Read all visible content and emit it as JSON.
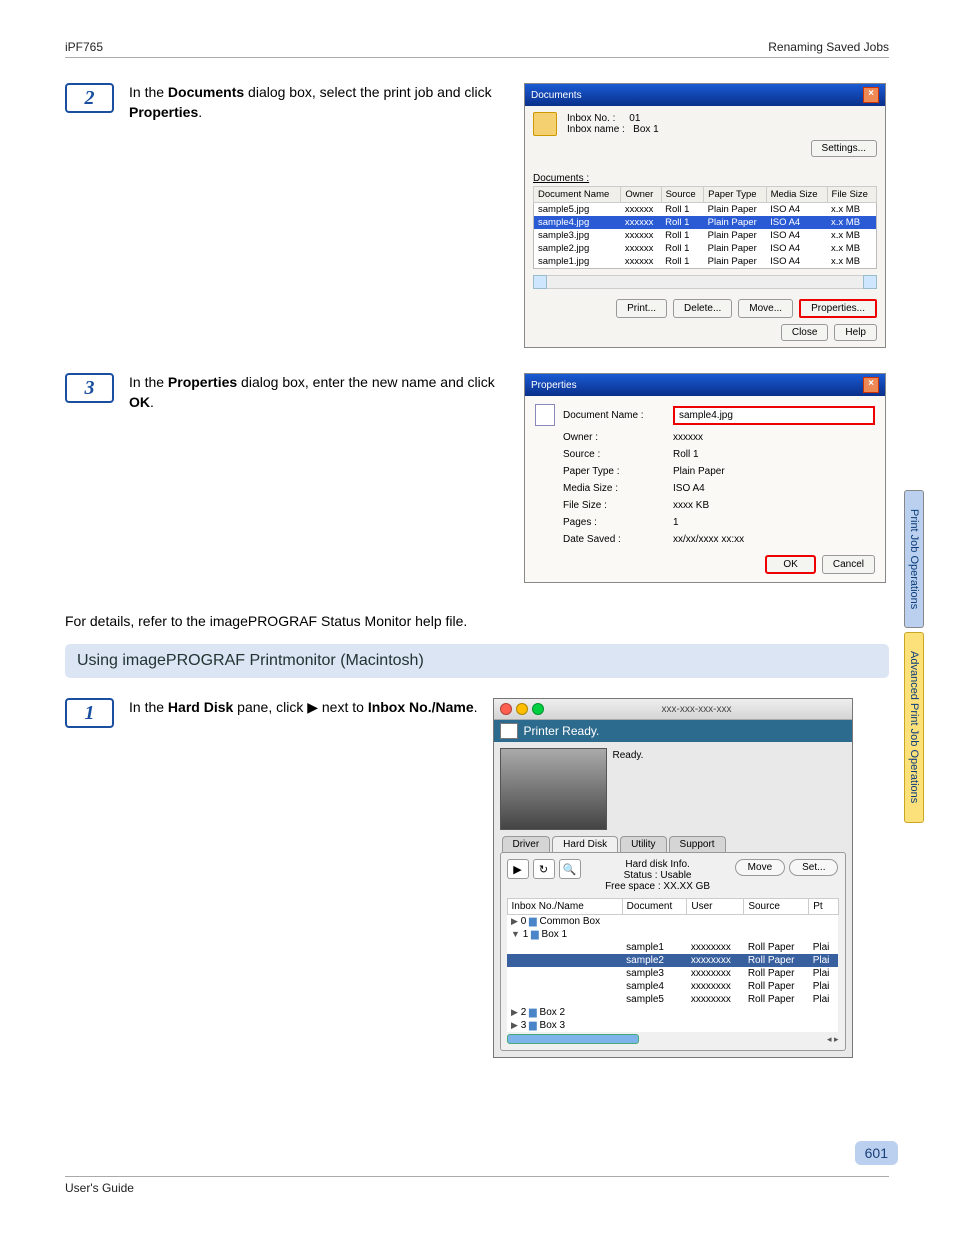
{
  "header": {
    "model": "iPF765",
    "section": "Renaming Saved Jobs"
  },
  "side_tabs": {
    "a": "Print Job Operations",
    "b": "Advanced Print Job Operations"
  },
  "page_number": "601",
  "footer": "User's Guide",
  "step2": {
    "text_before": "In the ",
    "b1": "Documents",
    "text_mid": " dialog box, select the print job and click ",
    "b2": "Properties",
    "text_after": "."
  },
  "step3": {
    "text_before": "In the ",
    "b1": "Properties",
    "text_mid": " dialog box, enter the new name and click ",
    "b2": "OK",
    "text_after": "."
  },
  "docs": {
    "title": "Documents",
    "inbox_no_k": "Inbox No. :",
    "inbox_no_v": "01",
    "inbox_name_k": "Inbox name :",
    "inbox_name_v": "Box 1",
    "settings": "Settings...",
    "list_label": "Documents :",
    "headers": {
      "name": "Document Name",
      "owner": "Owner",
      "source": "Source",
      "paper": "Paper Type",
      "media": "Media Size",
      "file": "File Size"
    },
    "rows": [
      {
        "name": "sample5.jpg",
        "owner": "xxxxxx",
        "source": "Roll 1",
        "paper": "Plain Paper",
        "media": "ISO A4",
        "file": "x.x MB"
      },
      {
        "name": "sample4.jpg",
        "owner": "xxxxxx",
        "source": "Roll 1",
        "paper": "Plain Paper",
        "media": "ISO A4",
        "file": "x.x MB",
        "sel": true
      },
      {
        "name": "sample3.jpg",
        "owner": "xxxxxx",
        "source": "Roll 1",
        "paper": "Plain Paper",
        "media": "ISO A4",
        "file": "x.x MB"
      },
      {
        "name": "sample2.jpg",
        "owner": "xxxxxx",
        "source": "Roll 1",
        "paper": "Plain Paper",
        "media": "ISO A4",
        "file": "x.x MB"
      },
      {
        "name": "sample1.jpg",
        "owner": "xxxxxx",
        "source": "Roll 1",
        "paper": "Plain Paper",
        "media": "ISO A4",
        "file": "x.x MB"
      }
    ],
    "btn_print": "Print...",
    "btn_delete": "Delete...",
    "btn_move": "Move...",
    "btn_props": "Properties...",
    "btn_close": "Close",
    "btn_help": "Help"
  },
  "props": {
    "title": "Properties",
    "name_k": "Document Name :",
    "name_v": "sample4.jpg",
    "rows": [
      {
        "k": "Owner :",
        "v": "xxxxxx"
      },
      {
        "k": "Source :",
        "v": "Roll 1"
      },
      {
        "k": "Paper Type :",
        "v": "Plain Paper"
      },
      {
        "k": "Media Size :",
        "v": "ISO A4"
      },
      {
        "k": "File Size :",
        "v": "xxxx KB"
      },
      {
        "k": "Pages :",
        "v": "1"
      },
      {
        "k": "Date Saved :",
        "v": "xx/xx/xxxx xx:xx"
      }
    ],
    "ok": "OK",
    "cancel": "Cancel"
  },
  "detail_line": "For details, refer to the imagePROGRAF Status Monitor help file.",
  "section_head": "Using imagePROGRAF Printmonitor (Macintosh)",
  "step1": {
    "a": "In the ",
    "b1": "Hard Disk",
    "b": " pane, click ",
    "c": " next to ",
    "b2": "Inbox No./Name",
    "d": "."
  },
  "mac": {
    "title": "xxx-xxx-xxx-xxx",
    "ready": "Printer Ready.",
    "status": "Ready.",
    "tabs": {
      "driver": "Driver",
      "hd": "Hard Disk",
      "util": "Utility",
      "support": "Support"
    },
    "info_title": "Hard disk Info.",
    "info_status": "Status : Usable",
    "info_free": "Free space : XX.XX GB",
    "btn_move": "Move",
    "btn_set": "Set...",
    "headers": {
      "inbox": "Inbox No./Name",
      "doc": "Document",
      "user": "User",
      "source": "Source",
      "pt": "Pt"
    },
    "tree": [
      {
        "label": "0",
        "name": "Common Box",
        "icon": "▶"
      },
      {
        "label": "1",
        "name": "Box 1",
        "icon": "▼"
      }
    ],
    "files": [
      {
        "doc": "sample1",
        "user": "xxxxxxxx",
        "source": "Roll Paper",
        "pt": "Plai"
      },
      {
        "doc": "sample2",
        "user": "xxxxxxxx",
        "source": "Roll Paper",
        "pt": "Plai",
        "sel": true
      },
      {
        "doc": "sample3",
        "user": "xxxxxxxx",
        "source": "Roll Paper",
        "pt": "Plai"
      },
      {
        "doc": "sample4",
        "user": "xxxxxxxx",
        "source": "Roll Paper",
        "pt": "Plai"
      },
      {
        "doc": "sample5",
        "user": "xxxxxxxx",
        "source": "Roll Paper",
        "pt": "Plai"
      }
    ],
    "tree2": [
      {
        "label": "2",
        "name": "Box 2"
      },
      {
        "label": "3",
        "name": "Box 3"
      }
    ]
  }
}
